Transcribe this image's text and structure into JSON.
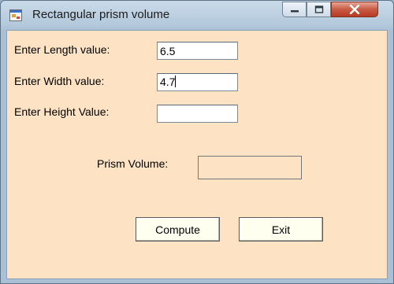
{
  "window": {
    "title": "Rectangular prism volume",
    "controls": {
      "minimize_icon": "minimize-icon",
      "maximize_icon": "maximize-icon",
      "close_icon": "close-icon"
    }
  },
  "form": {
    "length_label": "Enter Length value:",
    "length_value": "6.5",
    "width_label": "Enter Width value:",
    "width_value": "4.7",
    "height_label": "Enter Height Value:",
    "height_value": "",
    "volume_label": "Prism Volume:",
    "volume_value": ""
  },
  "buttons": {
    "compute_label": "Compute",
    "exit_label": "Exit"
  },
  "colors": {
    "form_background": "#fde3c3",
    "button_background": "#fffff0",
    "close_button": "#c75a44"
  }
}
